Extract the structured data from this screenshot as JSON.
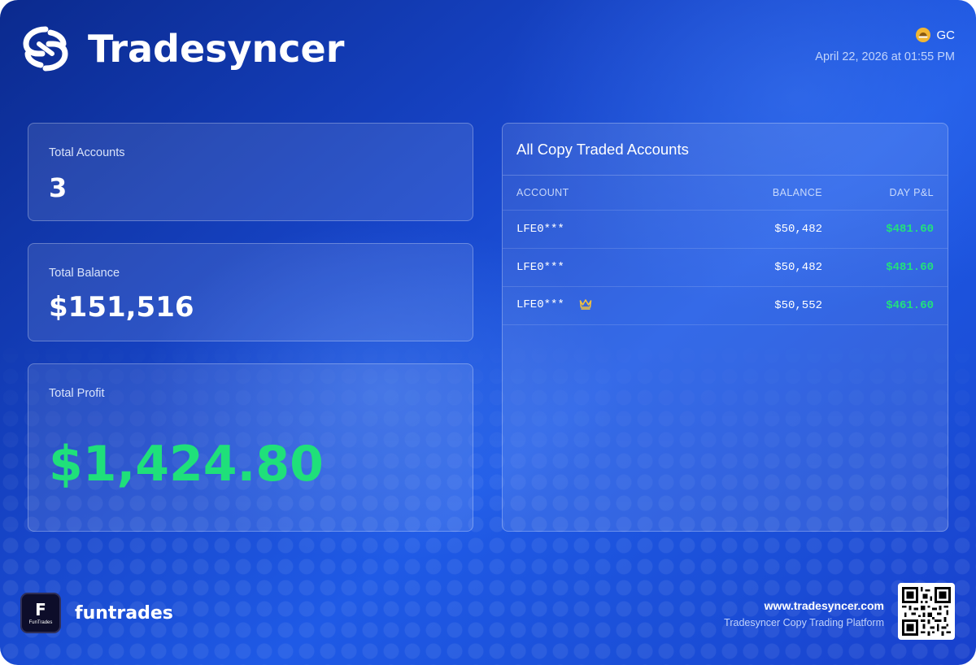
{
  "brand": {
    "name": "Tradesyncer",
    "logo_icon": "tradesyncer-logo-icon"
  },
  "user": {
    "name": "GC",
    "avatar_icon": "user-avatar-icon",
    "avatar_color": "#f2b632"
  },
  "timestamp": "April 22, 2026 at 01:55 PM",
  "stats": {
    "total_accounts": {
      "label": "Total Accounts",
      "value": "3"
    },
    "total_balance": {
      "label": "Total Balance",
      "value": "$151,516"
    },
    "total_profit": {
      "label": "Total Profit",
      "value": "$1,424.80",
      "color": "#1fe07a"
    }
  },
  "accounts_table": {
    "title": "All Copy Traded Accounts",
    "columns": {
      "account": "ACCOUNT",
      "balance": "BALANCE",
      "pnl": "DAY P&L"
    },
    "rows": [
      {
        "account": "LFE0***",
        "balance": "$50,482",
        "pnl": "$481.60",
        "icon": ""
      },
      {
        "account": "LFE0***",
        "balance": "$50,482",
        "pnl": "$481.60",
        "icon": ""
      },
      {
        "account": "LFE0***",
        "balance": "$50,552",
        "pnl": "$461.60",
        "icon": "crown-icon"
      }
    ],
    "positive_color": "#22e07d"
  },
  "footer": {
    "partner_name": "funtrades",
    "partner_logo": {
      "letter": "F",
      "caption": "FunTrades"
    },
    "website": "www.tradesyncer.com",
    "tagline": "Tradesyncer Copy Trading Platform",
    "qr_icon": "qr-code-icon"
  }
}
